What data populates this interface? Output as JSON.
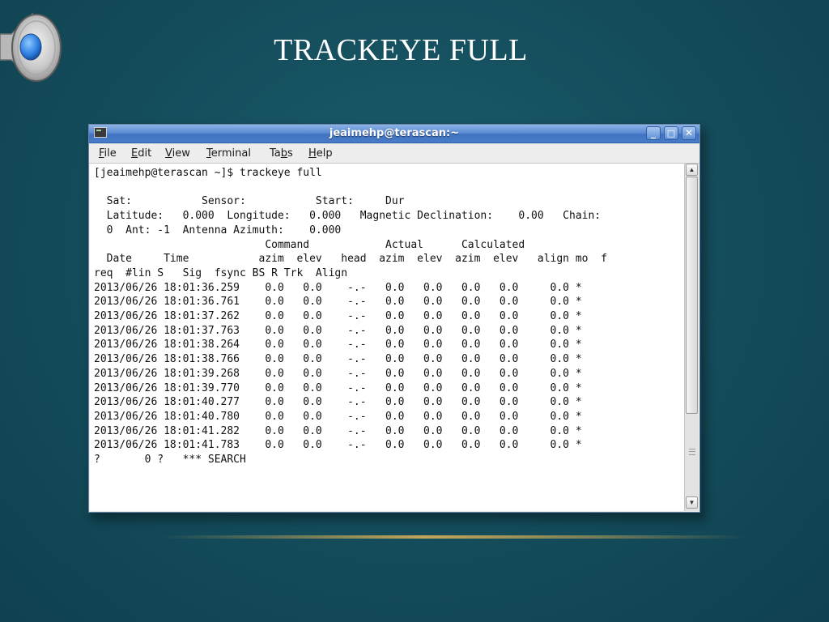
{
  "slide": {
    "title": "TRACKEYE FULL",
    "speaker_icon": "speaker-icon",
    "accent_colors": {
      "background": "#144c5b",
      "divider": "#d6b057"
    }
  },
  "window": {
    "title": "jeaimehp@terascan:~",
    "app_icon": "terminal-icon",
    "buttons": {
      "minimize": "_",
      "maximize": "□",
      "close": "✕"
    },
    "menu": [
      {
        "pre": "",
        "key": "F",
        "post": "ile"
      },
      {
        "pre": "",
        "key": "E",
        "post": "dit"
      },
      {
        "pre": "",
        "key": "V",
        "post": "iew"
      },
      {
        "pre": "",
        "key": "T",
        "post": "erminal"
      },
      {
        "pre": "Ta",
        "key": "b",
        "post": "s"
      },
      {
        "pre": "",
        "key": "H",
        "post": "elp"
      }
    ]
  },
  "terminal": {
    "lines": [
      "[jeaimehp@terascan ~]$ trackeye full",
      "",
      "  Sat:           Sensor:           Start:     Dur",
      "  Latitude:   0.000  Longitude:   0.000   Magnetic Declination:    0.00   Chain:",
      "  0  Ant: -1  Antenna Azimuth:    0.000",
      "                           Command            Actual      Calculated",
      "  Date     Time           azim  elev   head  azim  elev  azim  elev   align mo  f",
      "req  #lin S   Sig  fsync BS R Trk  Align",
      "2013/06/26 18:01:36.259    0.0   0.0    -.-   0.0   0.0   0.0   0.0     0.0 *",
      "2013/06/26 18:01:36.761    0.0   0.0    -.-   0.0   0.0   0.0   0.0     0.0 *",
      "2013/06/26 18:01:37.262    0.0   0.0    -.-   0.0   0.0   0.0   0.0     0.0 *",
      "2013/06/26 18:01:37.763    0.0   0.0    -.-   0.0   0.0   0.0   0.0     0.0 *",
      "2013/06/26 18:01:38.264    0.0   0.0    -.-   0.0   0.0   0.0   0.0     0.0 *",
      "2013/06/26 18:01:38.766    0.0   0.0    -.-   0.0   0.0   0.0   0.0     0.0 *",
      "2013/06/26 18:01:39.268    0.0   0.0    -.-   0.0   0.0   0.0   0.0     0.0 *",
      "2013/06/26 18:01:39.770    0.0   0.0    -.-   0.0   0.0   0.0   0.0     0.0 *",
      "2013/06/26 18:01:40.277    0.0   0.0    -.-   0.0   0.0   0.0   0.0     0.0 *",
      "2013/06/26 18:01:40.780    0.0   0.0    -.-   0.0   0.0   0.0   0.0     0.0 *",
      "2013/06/26 18:01:41.282    0.0   0.0    -.-   0.0   0.0   0.0   0.0     0.0 *",
      "2013/06/26 18:01:41.783    0.0   0.0    -.-   0.0   0.0   0.0   0.0     0.0 *",
      "?       0 ?   *** SEARCH"
    ]
  }
}
